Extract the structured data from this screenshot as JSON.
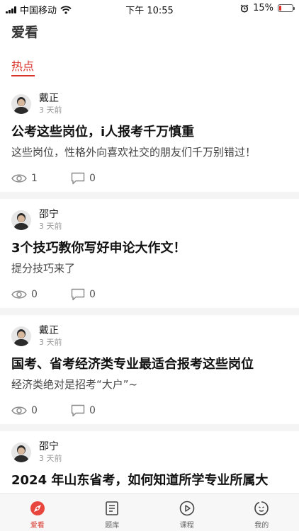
{
  "status_bar": {
    "carrier": "中国移动",
    "time": "下午 10:55",
    "battery_percent": "15%",
    "battery_level": 0.15,
    "icons": [
      "signal-icon",
      "wifi-icon",
      "alarm-icon",
      "battery-icon"
    ]
  },
  "page": {
    "title": "爱看"
  },
  "tabs": [
    {
      "label": "热点",
      "active": true
    }
  ],
  "posts": [
    {
      "author": "戴正",
      "time": "3 天前",
      "title": "公考这些岗位，i人报考千万慎重",
      "subtitle": "这些岗位，性格外向喜欢社交的朋友们千万别错过！",
      "views": "1",
      "comments": "0"
    },
    {
      "author": "邵宁",
      "time": "3 天前",
      "title": "3个技巧教你写好申论大作文！",
      "subtitle": "提分技巧来了",
      "views": "0",
      "comments": "0"
    },
    {
      "author": "戴正",
      "time": "3 天前",
      "title": "国考、省考经济类专业最适合报考这些岗位",
      "subtitle": "经济类绝对是招考“大户”~",
      "views": "0",
      "comments": "0"
    },
    {
      "author": "邵宁",
      "time": "3 天前",
      "title": "2024 年山东省考，如何知道所学专业所属大",
      "subtitle": "",
      "views": "",
      "comments": ""
    }
  ],
  "bottom_nav": [
    {
      "label": "爱看",
      "icon": "discover-icon",
      "active": true
    },
    {
      "label": "题库",
      "icon": "question-bank-icon",
      "active": false
    },
    {
      "label": "课程",
      "icon": "play-course-icon",
      "active": false
    },
    {
      "label": "我的",
      "icon": "profile-face-icon",
      "active": false
    }
  ],
  "colors": {
    "accent": "#d9342b",
    "separator": "#f4f4f4"
  }
}
